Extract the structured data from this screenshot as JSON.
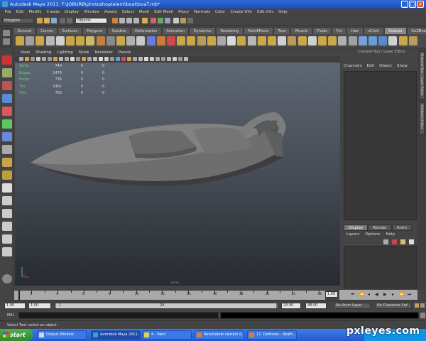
{
  "window": {
    "title": "Autodesk Maya 2011: F:\\JOBURB\\photoshoptalent\\boat\\boaT.mb*"
  },
  "menubar": [
    "File",
    "Edit",
    "Modify",
    "Create",
    "Display",
    "Window",
    "Assets",
    "Select",
    "Mesh",
    "Edit Mesh",
    "Proxy",
    "Normals",
    "Color",
    "Create UVs",
    "Edit UVs",
    "Help"
  ],
  "statusline": {
    "mode": "Polygons",
    "objects_field": "Objects"
  },
  "shelf": {
    "tabs": [
      "General",
      "Curves",
      "Surfaces",
      "Polygons",
      "Subdivs",
      "Deformation",
      "Animation",
      "Dynamics",
      "Rendering",
      "PaintEffects",
      "Toon",
      "Muscle",
      "Fluids",
      "Fur",
      "Hair",
      "nCloth",
      "Custom",
      "GoZBrush"
    ],
    "active_tab": "Custom"
  },
  "viewport": {
    "menu": [
      "View",
      "Shading",
      "Lighting",
      "Show",
      "Renderer",
      "Panels"
    ],
    "hud": [
      {
        "label": "Verts:",
        "v1": "744",
        "v2": "0",
        "v3": "0"
      },
      {
        "label": "Edges:",
        "v1": "1476",
        "v2": "0",
        "v3": "0"
      },
      {
        "label": "Faces:",
        "v1": "736",
        "v2": "0",
        "v3": "0"
      },
      {
        "label": "Tris:",
        "v1": "1462",
        "v2": "0",
        "v3": "0"
      },
      {
        "label": "UVs:",
        "v1": "792",
        "v2": "0",
        "v3": "0"
      }
    ],
    "camera_label": "persp"
  },
  "channel_box": {
    "header": "Channel Box / Layer Editor",
    "menu": [
      "Channels",
      "Edit",
      "Object",
      "Show"
    ],
    "side_tabs": [
      "Channel Box / Layer Editor",
      "Attribute Editor"
    ]
  },
  "layer_editor": {
    "tabs": [
      "Display",
      "Render",
      "Anim"
    ],
    "active_tab": "Display",
    "menu": [
      "Layers",
      "Options",
      "Help"
    ]
  },
  "timeline": {
    "ticks": [
      "2",
      "4",
      "6",
      "8",
      "10",
      "12",
      "14",
      "16",
      "18",
      "20",
      "22",
      "24"
    ],
    "current_frame": "1.00"
  },
  "range": {
    "start": "1.00",
    "inner_start": "1.00",
    "slider_min": "1",
    "slider_max": "24",
    "end_inner": "24.00",
    "end": "48.00",
    "anim_layer": "No Anim Layer",
    "character_set": "No Character Set"
  },
  "command": {
    "label": "MEL"
  },
  "helpline": {
    "text": "Select Tool: select an object"
  },
  "taskbar": {
    "start_label": "start",
    "tasks": [
      {
        "label": "Output Window",
        "icon_color": "#d8d8d8"
      },
      {
        "label": "Autodesk Maya 2011: ...",
        "icon_color": "#2aa8c8"
      },
      {
        "label": "4 - Paint",
        "icon_color": "#e8d24a"
      },
      {
        "label": "Rezultatele căutării d...",
        "icon_color": "#e87a2a"
      },
      {
        "label": "17. Deftones - death...",
        "icon_color": "#e8782a"
      }
    ]
  },
  "watermark": "pxleyes.com"
}
